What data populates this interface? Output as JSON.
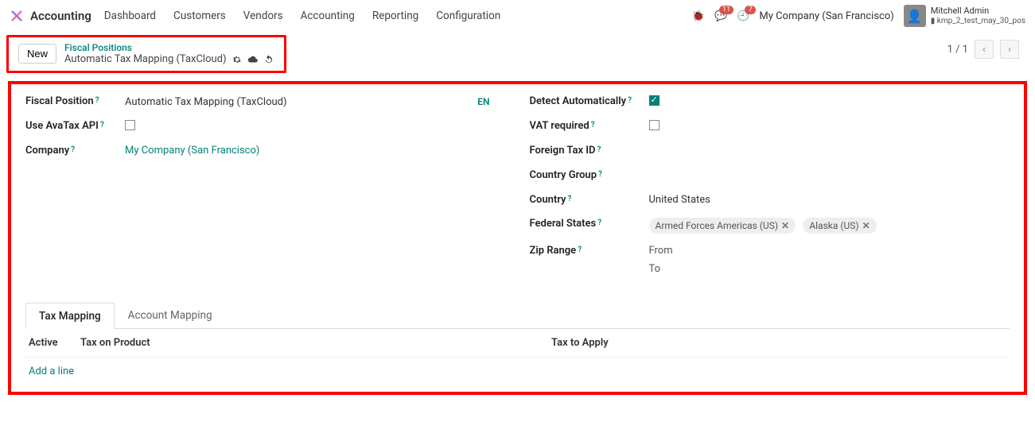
{
  "header": {
    "app_title": "Accounting",
    "menu": [
      "Dashboard",
      "Customers",
      "Vendors",
      "Accounting",
      "Reporting",
      "Configuration"
    ],
    "messages_count": "11",
    "activities_count": "7",
    "company": "My Company (San Francisco)",
    "user_name": "Mitchell Admin",
    "db_name": "kmp_2_test_may_30_pos"
  },
  "crumb": {
    "new_label": "New",
    "parent": "Fiscal Positions",
    "current": "Automatic Tax Mapping (TaxCloud)"
  },
  "pager": {
    "text": "1 / 1",
    "prev": "‹",
    "next": "›"
  },
  "form": {
    "left": {
      "fiscal_position_label": "Fiscal Position",
      "fiscal_position_value": "Automatic Tax Mapping (TaxCloud)",
      "lang_tag": "EN",
      "use_avatax_label": "Use AvaTax API",
      "company_label": "Company",
      "company_value": "My Company (San Francisco)"
    },
    "right": {
      "detect_label": "Detect Automatically",
      "vat_label": "VAT required",
      "foreign_tax_label": "Foreign Tax ID",
      "country_group_label": "Country Group",
      "country_label": "Country",
      "country_value": "United States",
      "states_label": "Federal States",
      "states": [
        "Armed Forces Americas (US)",
        "Alaska (US)"
      ],
      "zip_label": "Zip Range",
      "zip_from": "From",
      "zip_to": "To"
    }
  },
  "tabs": {
    "tax_mapping": "Tax Mapping",
    "account_mapping": "Account Mapping"
  },
  "table": {
    "col_active": "Active",
    "col_tax_product": "Tax on Product",
    "col_tax_apply": "Tax to Apply",
    "add_line": "Add a line"
  }
}
